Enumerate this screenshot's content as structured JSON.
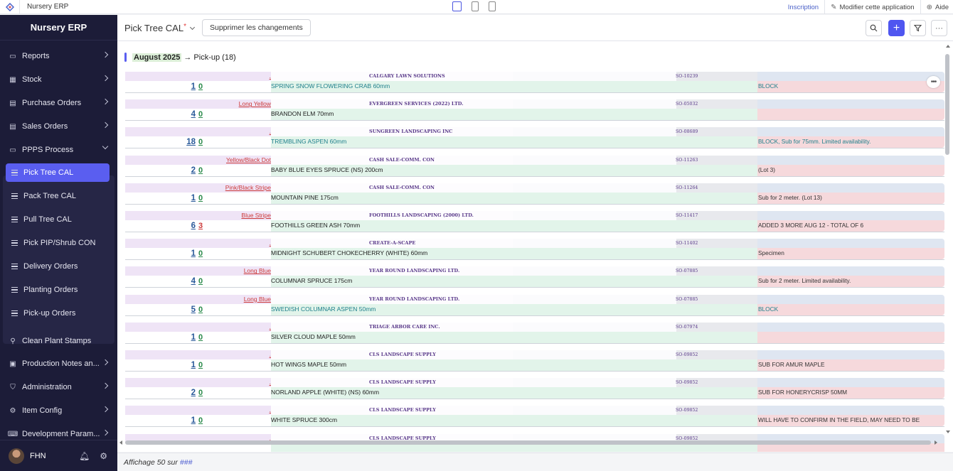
{
  "topbar": {
    "app_name": "Nursery ERP",
    "signup": "Inscription",
    "edit_app": "Modifier cette application",
    "help": "Aide"
  },
  "sidebar": {
    "brand": "Nursery ERP",
    "items": [
      {
        "label": "Reports",
        "icon": "monitor-icon"
      },
      {
        "label": "Stock",
        "icon": "grid-icon"
      },
      {
        "label": "Purchase Orders",
        "icon": "document-icon"
      },
      {
        "label": "Sales Orders",
        "icon": "document-icon"
      },
      {
        "label": "PPPS Process",
        "icon": "monitor-icon"
      }
    ],
    "ppps_sub": [
      {
        "label": "Pick Tree CAL",
        "active": true
      },
      {
        "label": "Pack Tree CAL"
      },
      {
        "label": "Pull Tree CAL"
      },
      {
        "label": "Pick PIP/Shrub CON"
      },
      {
        "label": "Delivery Orders"
      },
      {
        "label": "Planting Orders"
      },
      {
        "label": "Pick-up Orders"
      }
    ],
    "items_after": [
      {
        "label": "Clean Plant Stamps",
        "icon": "stamp-icon"
      },
      {
        "label": "Production Notes an...",
        "icon": "printer-icon"
      },
      {
        "label": "Administration",
        "icon": "shield-icon"
      },
      {
        "label": "Item Config",
        "icon": "gear-icon"
      },
      {
        "label": "Development Param...",
        "icon": "code-icon"
      }
    ],
    "user": "FHN"
  },
  "header": {
    "title": "Pick Tree CAL",
    "unsaved_marker": "*",
    "discard_button": "Supprimer les changements"
  },
  "group": {
    "month": "August 2025",
    "arrow": "→",
    "label": "Pick-up (18)"
  },
  "rows": [
    {
      "tag": ".",
      "customer": "CALGARY LAWN SOLUTIONS",
      "so": "SO-10239",
      "qty": "1",
      "picked": "0",
      "item": "SPRING SNOW FLOWERING CRAB 60mm",
      "item_teal": true,
      "note": "BLOCK",
      "note_teal": true
    },
    {
      "tag": "Long Yellow",
      "customer": "EVERGREEN SERVICES (2022) LTD.",
      "so": "SO-05032",
      "qty": "4",
      "picked": "0",
      "item": "BRANDON ELM 70mm",
      "note": ""
    },
    {
      "tag": ".",
      "customer": "SUNGREEN LANDSCAPING INC",
      "so": "SO-08689",
      "qty": "18",
      "picked": "0",
      "item": "TREMBLING ASPEN 60mm",
      "item_teal": true,
      "note": "BLOCK, Sub for 75mm. Limited availability.",
      "note_teal": true
    },
    {
      "tag": "Yellow/Black Dot",
      "customer": "CASH SALE-COMM. CON",
      "so": "SO-11263",
      "qty": "2",
      "picked": "0",
      "item": "BABY BLUE EYES SPRUCE (NS) 200cm",
      "note": "(Lot 3)"
    },
    {
      "tag": "Pink/Black Stripe",
      "customer": "CASH SALE-COMM. CON",
      "so": "SO-11264",
      "qty": "1",
      "picked": "0",
      "item": "MOUNTAIN PINE 175cm",
      "note": "Sub for 2 meter. (Lot 13)"
    },
    {
      "tag": "Blue Stripe",
      "customer": "FOOTHILLS LANDSCAPING (2000) LTD.",
      "so": "SO-11417",
      "qty": "6",
      "picked": "3",
      "picked_red": true,
      "item": "FOOTHILLS GREEN ASH 70mm",
      "note": "ADDED 3 MORE AUG 12 - TOTAL OF 6"
    },
    {
      "tag": ".",
      "customer": "CREATE-A-SCAPE",
      "so": "SO-11402",
      "qty": "1",
      "picked": "0",
      "item": "MIDNIGHT SCHUBERT CHOKECHERRY (WHITE) 60mm",
      "note": "Specimen"
    },
    {
      "tag": "Long Blue",
      "customer": "YEAR ROUND LANDSCAPING LTD.",
      "so": "SO-07885",
      "qty": "4",
      "picked": "0",
      "item": "COLUMNAR SPRUCE 175cm",
      "note": "Sub for 2 meter. Limited availability."
    },
    {
      "tag": "Long Blue",
      "customer": "YEAR ROUND LANDSCAPING LTD.",
      "so": "SO-07885",
      "qty": "5",
      "picked": "0",
      "item": "SWEDISH COLUMNAR ASPEN 50mm",
      "item_teal": true,
      "note": "BLOCK",
      "note_teal": true
    },
    {
      "tag": ".",
      "customer": "TRIAGE ARBOR CARE INC.",
      "so": "SO-07974",
      "qty": "1",
      "picked": "0",
      "item": "SILVER CLOUD MAPLE 50mm",
      "note": ""
    },
    {
      "tag": ".",
      "customer": "CLS LANDSCAPE SUPPLY",
      "so": "SO-09852",
      "qty": "1",
      "picked": "0",
      "item": "HOT WINGS MAPLE 50mm",
      "note": "SUB FOR AMUR MAPLE"
    },
    {
      "tag": ".",
      "customer": "CLS LANDSCAPE SUPPLY",
      "so": "SO-09852",
      "qty": "2",
      "picked": "0",
      "item": "NORLAND APPLE (WHITE) (NS) 60mm",
      "note": "SUB FOR HONERYCRISP 50MM"
    },
    {
      "tag": ".",
      "customer": "CLS LANDSCAPE SUPPLY",
      "so": "SO-09852",
      "qty": "1",
      "picked": "0",
      "item": "WHITE SPRUCE 300cm",
      "note": "WILL HAVE TO CONFIRM IN THE FIELD, MAY NEED TO BE"
    },
    {
      "tag": ".",
      "customer": "CLS LANDSCAPE SUPPLY",
      "so": "SO-09852",
      "qty": "",
      "picked": "",
      "item": "",
      "note": ""
    }
  ],
  "status": {
    "prefix": "Affichage 50 sur",
    "total": "###"
  }
}
